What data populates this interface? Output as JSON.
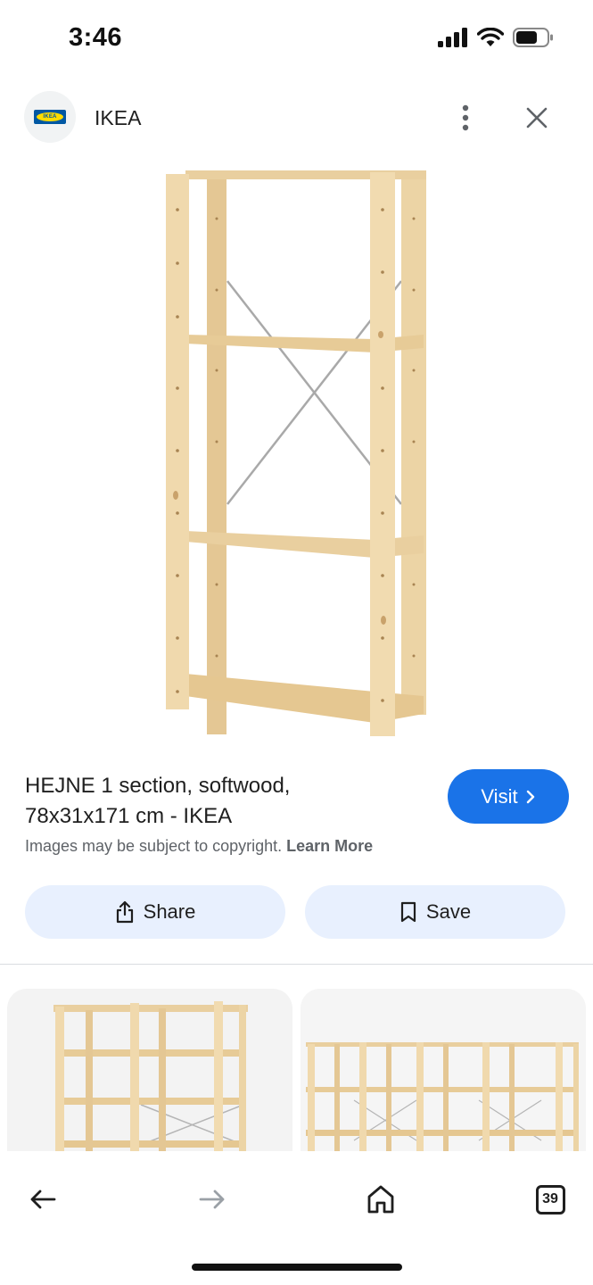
{
  "status_bar": {
    "time": "3:46"
  },
  "header": {
    "site_logo_text": "IKEA",
    "site_name": "IKEA",
    "more_icon": "more-vertical-icon",
    "close_icon": "close-icon"
  },
  "result": {
    "title_line1": "HEJNE 1 section, softwood,",
    "title_line2": "78x31x171 cm - IKEA",
    "visit_label": "Visit",
    "copyright_text": "Images may be subject to copyright.",
    "learn_more": "Learn More",
    "share_label": "Share",
    "save_label": "Save"
  },
  "bottom_nav": {
    "back_icon": "arrow-left-icon",
    "forward_icon": "arrow-right-icon",
    "home_icon": "home-icon",
    "tabs_count": "39"
  },
  "colors": {
    "accent": "#1a73e8",
    "button_bg": "#e8f0fe",
    "wood": "#e9cf9f"
  }
}
